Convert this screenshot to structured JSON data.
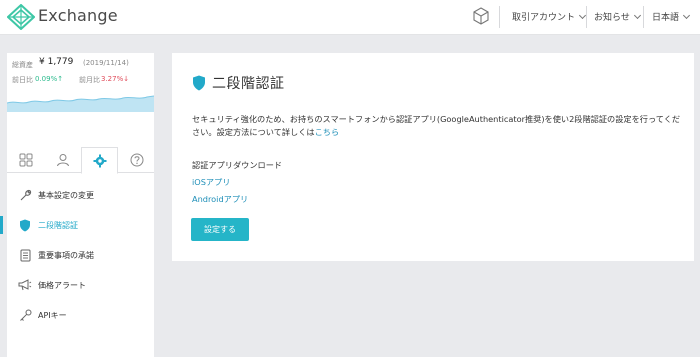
{
  "header": {
    "brand": "Exchange",
    "menu": [
      {
        "label": "取引アカウント"
      },
      {
        "label": "お知らせ"
      },
      {
        "label": "日本語"
      }
    ]
  },
  "sidebar": {
    "balance_label": "総資産",
    "balance_value": "¥ 1,779",
    "balance_date": "(2019/11/14)",
    "prev_day_label": "前日比",
    "prev_day_value": "0.09%↑",
    "prev_month_label": "前月比",
    "prev_month_value": "3.27%↓",
    "nav": [
      {
        "label": "基本設定の変更",
        "icon": "wrench-icon"
      },
      {
        "label": "二段階認証",
        "icon": "shield-icon"
      },
      {
        "label": "重要事項の承諾",
        "icon": "document-icon"
      },
      {
        "label": "価格アラート",
        "icon": "megaphone-icon"
      },
      {
        "label": "APIキー",
        "icon": "key-icon"
      }
    ]
  },
  "main": {
    "title": "二段階認証",
    "description_pre": "セキュリティ強化のため、お持ちのスマートフォンから認証アプリ(GoogleAuthenticator推奨)を使い2段階認証の設定を行ってください。設定方法について詳しくは",
    "description_link": "こちら",
    "download_title": "認証アプリダウンロード",
    "ios_link": "iOSアプリ",
    "android_link": "Androidアプリ",
    "setup_button": "設定する"
  },
  "colors": {
    "accent": "#22a9c9",
    "button": "#25b5c8",
    "up": "#2dbb8e",
    "down": "#e04b5a"
  }
}
